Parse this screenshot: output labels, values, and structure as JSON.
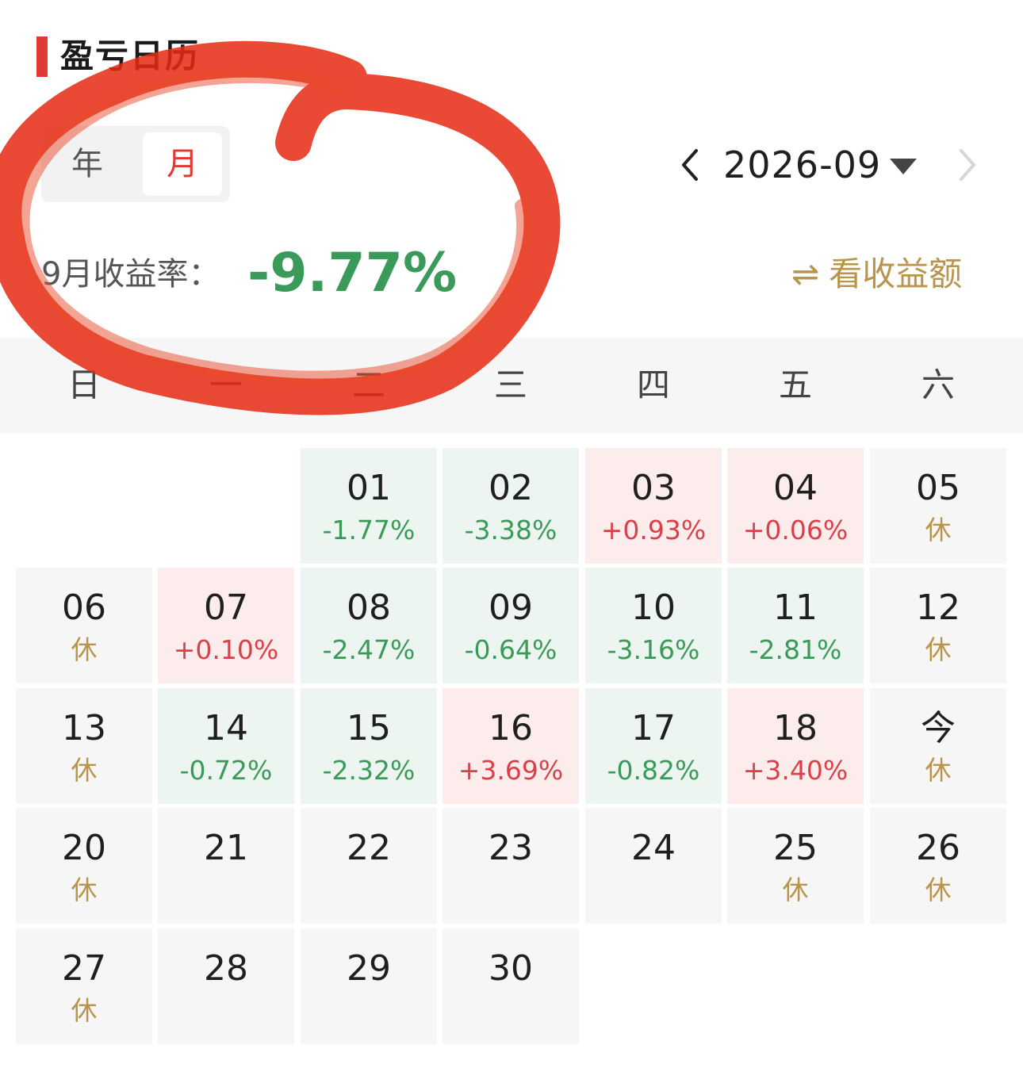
{
  "header": {
    "title": "盈亏日历",
    "accent_color": "#e03a33"
  },
  "segment": {
    "items": [
      "年",
      "月"
    ],
    "selected": "月"
  },
  "month_nav": {
    "label": "2026-09",
    "prev_icon": "chevron-left-icon",
    "next_icon": "chevron-right-icon",
    "dropdown_icon": "triangle-down-icon"
  },
  "summary": {
    "label": "9月收益率：",
    "value": "-9.77%",
    "value_color": "#3a9a5a"
  },
  "toggle": {
    "icon": "⇌",
    "label": "看收益额",
    "color": "#b8944c"
  },
  "weekdays": [
    "日",
    "一",
    "二",
    "三",
    "四",
    "五",
    "六"
  ],
  "calendar": [
    [
      null,
      null,
      {
        "day": "01",
        "sub": "-1.77%",
        "type": "loss"
      },
      {
        "day": "02",
        "sub": "-3.38%",
        "type": "loss"
      },
      {
        "day": "03",
        "sub": "+0.93%",
        "type": "gain"
      },
      {
        "day": "04",
        "sub": "+0.06%",
        "type": "gain"
      },
      {
        "day": "05",
        "sub": "休",
        "type": "rest"
      }
    ],
    [
      {
        "day": "06",
        "sub": "休",
        "type": "rest"
      },
      {
        "day": "07",
        "sub": "+0.10%",
        "type": "gain"
      },
      {
        "day": "08",
        "sub": "-2.47%",
        "type": "loss"
      },
      {
        "day": "09",
        "sub": "-0.64%",
        "type": "loss"
      },
      {
        "day": "10",
        "sub": "-3.16%",
        "type": "loss"
      },
      {
        "day": "11",
        "sub": "-2.81%",
        "type": "loss"
      },
      {
        "day": "12",
        "sub": "休",
        "type": "rest"
      }
    ],
    [
      {
        "day": "13",
        "sub": "休",
        "type": "rest"
      },
      {
        "day": "14",
        "sub": "-0.72%",
        "type": "loss"
      },
      {
        "day": "15",
        "sub": "-2.32%",
        "type": "loss"
      },
      {
        "day": "16",
        "sub": "+3.69%",
        "type": "gain"
      },
      {
        "day": "17",
        "sub": "-0.82%",
        "type": "loss"
      },
      {
        "day": "18",
        "sub": "+3.40%",
        "type": "gain"
      },
      {
        "day": "今",
        "sub": "休",
        "type": "rest"
      }
    ],
    [
      {
        "day": "20",
        "sub": "休",
        "type": "rest"
      },
      {
        "day": "21",
        "sub": "",
        "type": "none"
      },
      {
        "day": "22",
        "sub": "",
        "type": "none"
      },
      {
        "day": "23",
        "sub": "",
        "type": "none"
      },
      {
        "day": "24",
        "sub": "",
        "type": "none"
      },
      {
        "day": "25",
        "sub": "休",
        "type": "rest"
      },
      {
        "day": "26",
        "sub": "休",
        "type": "rest"
      }
    ],
    [
      {
        "day": "27",
        "sub": "休",
        "type": "rest"
      },
      {
        "day": "28",
        "sub": "",
        "type": "none"
      },
      {
        "day": "29",
        "sub": "",
        "type": "none"
      },
      {
        "day": "30",
        "sub": "",
        "type": "none"
      },
      null,
      null,
      null
    ]
  ],
  "colors": {
    "loss": "#3a9a5a",
    "gain": "#d9414a",
    "rest": "#b8944c",
    "loss_bg": "#edf5f0",
    "gain_bg": "#fcecec",
    "cell_bg": "#f6f6f6"
  },
  "overlay": {
    "description_icon": "red-circle-annotation",
    "color": "#e52b14"
  }
}
